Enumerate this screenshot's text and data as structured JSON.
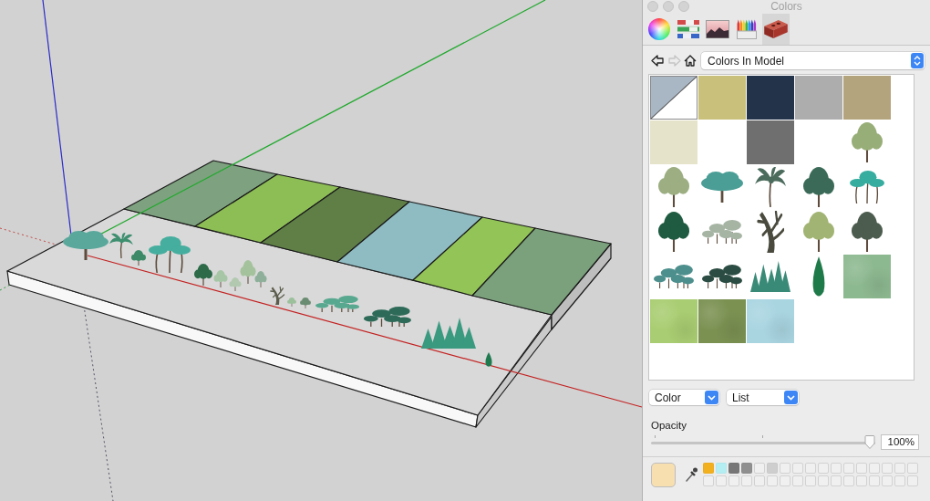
{
  "viewport": {
    "texture_panels": [
      {
        "color": "#7ea27f"
      },
      {
        "color": "#8dbd55"
      },
      {
        "color": "#5f7f47"
      },
      {
        "color": "#8fbcc2"
      },
      {
        "color": "#93c457"
      },
      {
        "color": "#7ba07c"
      }
    ],
    "plants": [
      {
        "kind": "broad",
        "color": "#5aa89c"
      },
      {
        "kind": "palm",
        "color": "#3e8f70"
      },
      {
        "kind": "round",
        "color": "#3d8a68"
      },
      {
        "kind": "palms",
        "color": "#45ae9e"
      },
      {
        "kind": "round",
        "color": "#2c6a48"
      },
      {
        "kind": "round",
        "color": "#a6c6a6"
      },
      {
        "kind": "round",
        "color": "#b2c9b0"
      },
      {
        "kind": "round",
        "color": "#a4c29c"
      },
      {
        "kind": "round",
        "color": "#8eb09a"
      },
      {
        "kind": "bare",
        "color": "#5c5c4c"
      },
      {
        "kind": "round",
        "color": "#9cc09c"
      },
      {
        "kind": "round",
        "color": "#6a8c72"
      },
      {
        "kind": "shrubs",
        "color": "#58a890"
      },
      {
        "kind": "shrubs",
        "color": "#2e6a58"
      },
      {
        "kind": "conifers",
        "color": "#3a9a80"
      },
      {
        "kind": "cypress",
        "color": "#1f7a50"
      }
    ]
  },
  "window": {
    "title": "Colors"
  },
  "tabs": [
    {
      "kind": "wheel",
      "selected": false
    },
    {
      "kind": "sliders",
      "selected": false
    },
    {
      "kind": "image",
      "selected": false
    },
    {
      "kind": "crayons",
      "selected": false
    },
    {
      "kind": "brick",
      "selected": true
    }
  ],
  "navigation": {
    "back": {
      "disabled": false
    },
    "forward": {
      "disabled": true
    },
    "collection": "Colors In Model"
  },
  "swatches": [
    {
      "kind": "default",
      "color": "#a9b6c4"
    },
    {
      "kind": "color",
      "color": "#c9c07b"
    },
    {
      "kind": "color",
      "color": "#23334a"
    },
    {
      "kind": "color",
      "color": "#adadad"
    },
    {
      "kind": "color",
      "color": "#b4a47d"
    },
    {
      "kind": "color",
      "color": "#e5e3c9"
    },
    {
      "kind": "blank"
    },
    {
      "kind": "color",
      "color": "#6f6f6f"
    },
    {
      "kind": "blank"
    },
    {
      "kind": "round",
      "color": "#98ae78"
    },
    {
      "kind": "round",
      "color": "#9cae82"
    },
    {
      "kind": "broad",
      "color": "#4a9e96"
    },
    {
      "kind": "palm",
      "color": "#4b6b5c"
    },
    {
      "kind": "round",
      "color": "#3b6b58"
    },
    {
      "kind": "palms",
      "color": "#36ad9f"
    },
    {
      "kind": "round",
      "color": "#1f5b40"
    },
    {
      "kind": "shrubs",
      "color": "#a6b4a4"
    },
    {
      "kind": "bare",
      "color": "#4a4a3e"
    },
    {
      "kind": "round",
      "color": "#a2b474"
    },
    {
      "kind": "round",
      "color": "#4c5c4e"
    },
    {
      "kind": "shrubs",
      "color": "#4d8f8c"
    },
    {
      "kind": "shrubs",
      "color": "#2b4c42"
    },
    {
      "kind": "conifers",
      "color": "#3a8a78"
    },
    {
      "kind": "cypress",
      "color": "#1f7a4a"
    },
    {
      "kind": "texture",
      "color": "#8db990"
    },
    {
      "kind": "texture",
      "color": "#a9cd72"
    },
    {
      "kind": "texture",
      "color": "#7b9152"
    },
    {
      "kind": "texture",
      "color": "#a9d5e1"
    }
  ],
  "color_mode": "Color",
  "view_mode": "List",
  "opacity": {
    "label": "Opacity",
    "level": 1,
    "reading": "100%"
  },
  "current_color": {
    "color": "#f7dfb0"
  },
  "wells": [
    {
      "empty": false,
      "color": "#f2b01e"
    },
    {
      "empty": false,
      "color": "#b4eef2"
    },
    {
      "empty": false,
      "color": "#777777"
    },
    {
      "empty": false,
      "color": "#8f8f8f"
    },
    {
      "empty": true
    },
    {
      "empty": false,
      "color": "#cecece"
    },
    {
      "empty": true
    },
    {
      "empty": true
    },
    {
      "empty": true
    },
    {
      "empty": true
    },
    {
      "empty": true
    },
    {
      "empty": true
    },
    {
      "empty": true
    },
    {
      "empty": true
    },
    {
      "empty": true
    },
    {
      "empty": true
    },
    {
      "empty": true
    },
    {
      "empty": true
    },
    {
      "empty": true
    },
    {
      "empty": true
    },
    {
      "empty": true
    },
    {
      "empty": true
    },
    {
      "empty": true
    },
    {
      "empty": true
    },
    {
      "empty": true
    },
    {
      "empty": true
    },
    {
      "empty": true
    },
    {
      "empty": true
    },
    {
      "empty": true
    },
    {
      "empty": true
    },
    {
      "empty": true
    },
    {
      "empty": true
    },
    {
      "empty": true
    },
    {
      "empty": true
    }
  ]
}
